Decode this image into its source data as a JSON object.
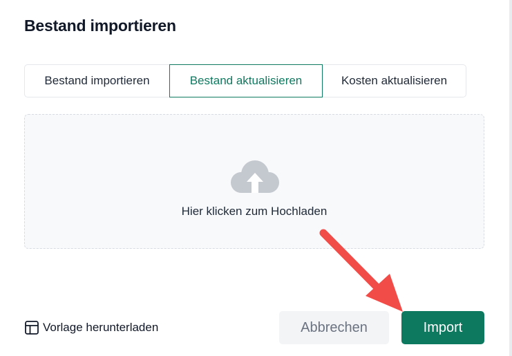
{
  "dialog": {
    "title": "Bestand importieren"
  },
  "tabs": [
    {
      "label": "Bestand importieren",
      "active": false
    },
    {
      "label": "Bestand aktualisieren",
      "active": true
    },
    {
      "label": "Kosten aktualisieren",
      "active": false
    }
  ],
  "dropzone": {
    "icon": "cloud-upload-icon",
    "text": "Hier klicken zum Hochladen"
  },
  "footer": {
    "template_icon": "table-layout-icon",
    "template_label": "Vorlage herunterladen",
    "cancel_label": "Abbrechen",
    "import_label": "Import"
  },
  "annotation": {
    "icon": "red-pointer-arrow",
    "color": "#f24c48"
  },
  "colors": {
    "accent": "#0d7a5f",
    "cancel_bg": "#f3f4f6",
    "icon_gray": "#c4c8cf"
  }
}
